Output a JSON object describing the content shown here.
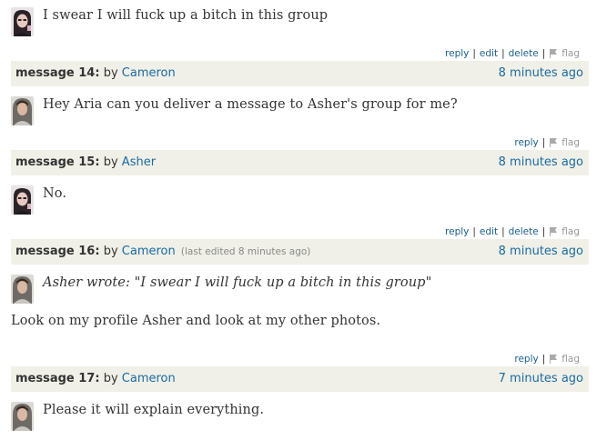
{
  "messages": [
    {
      "avatar": "avatar-dark-hair-icon",
      "body": "I swear I will fuck up a bitch in this group",
      "actions": [
        "reply",
        "edit",
        "delete",
        "flag"
      ]
    },
    {
      "header": {
        "number": "message 14:",
        "by": "by",
        "user": "Cameron",
        "edited": "",
        "time": "8 minutes ago"
      },
      "avatar": "avatar-hooded-icon",
      "body": "Hey Aria can you deliver a message to Asher's group for me?",
      "actions": [
        "reply",
        "flag"
      ]
    },
    {
      "header": {
        "number": "message 15:",
        "by": "by",
        "user": "Asher",
        "edited": "",
        "time": "8 minutes ago"
      },
      "avatar": "avatar-dark-hair-icon",
      "body": "No.",
      "actions": [
        "reply",
        "edit",
        "delete",
        "flag"
      ]
    },
    {
      "header": {
        "number": "message 16:",
        "by": "by",
        "user": "Cameron",
        "edited": "(last edited 8 minutes ago)",
        "time": "8 minutes ago"
      },
      "avatar": "avatar-hooded-icon",
      "quote": "Asher wrote: \"I swear I will fuck up a bitch in this group\"",
      "body": "Look on my profile Asher and look at my other photos.",
      "actions": [
        "reply",
        "flag"
      ]
    },
    {
      "header": {
        "number": "message 17:",
        "by": "by",
        "user": "Cameron",
        "edited": "",
        "time": "7 minutes ago"
      },
      "avatar": "avatar-hooded-icon",
      "body": "Please it will explain everything."
    }
  ],
  "colors": {
    "link": "#1a6aa0",
    "header_bg": "#f0f0e8",
    "flag": "#999999"
  }
}
